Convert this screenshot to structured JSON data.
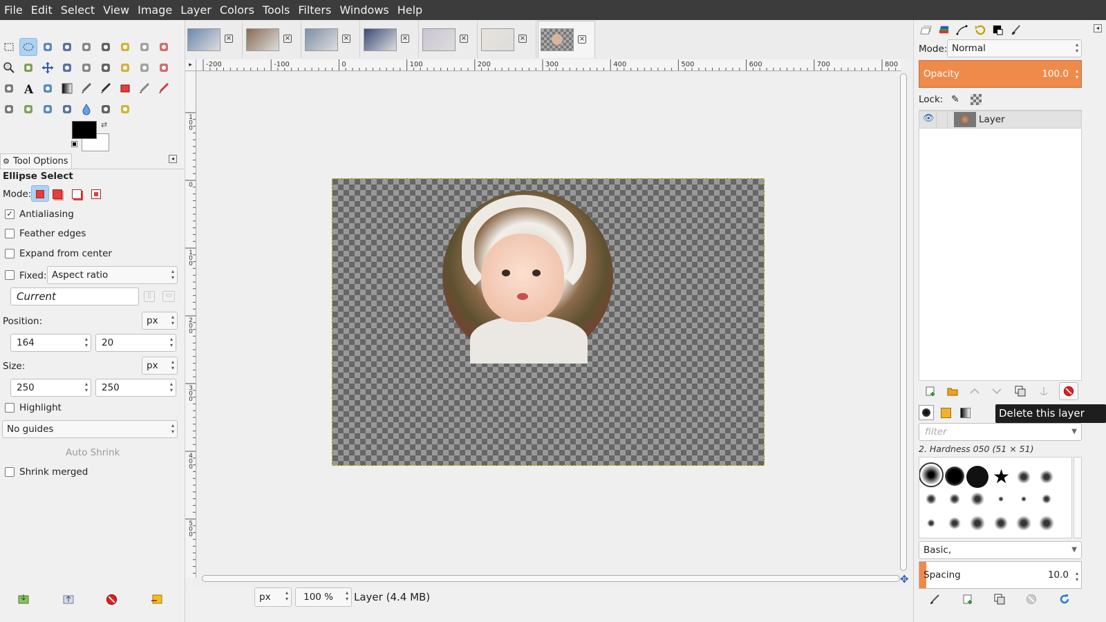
{
  "menu": [
    "File",
    "Edit",
    "Select",
    "View",
    "Image",
    "Layer",
    "Colors",
    "Tools",
    "Filters",
    "Windows",
    "Help"
  ],
  "toolbox": {
    "tools": [
      "rect-select",
      "ellipse-select",
      "free-select",
      "fuzzy-select",
      "select-by-color",
      "scissors-select",
      "foreground-select",
      "paths",
      "color-picker",
      "zoom",
      "measure",
      "move",
      "alignment",
      "crop",
      "unified-transform",
      "handle-transform",
      "warp-transform",
      "cage-transform",
      "flip",
      "text",
      "bucket-fill",
      "gradient",
      "pencil",
      "paintbrush",
      "eraser",
      "airbrush",
      "ink",
      "mypaint-brush",
      "clone",
      "heal",
      "perspective-clone",
      "blur",
      "smudge",
      "dodge"
    ]
  },
  "tool_options": {
    "tab_label": "Tool Options",
    "tool_name": "Ellipse Select",
    "mode_label": "Mode:",
    "antialiasing": "Antialiasing",
    "feather": "Feather edges",
    "expand": "Expand from center",
    "fixed": "Fixed:",
    "fixed_value": "Aspect ratio",
    "current": "Current",
    "position_label": "Position:",
    "position_unit": "px",
    "pos_x": "164",
    "pos_y": "20",
    "size_label": "Size:",
    "size_unit": "px",
    "size_w": "250",
    "size_h": "250",
    "highlight": "Highlight",
    "guides": "No guides",
    "auto_shrink": "Auto Shrink",
    "shrink_merged": "Shrink merged",
    "antialiasing_checked": true
  },
  "image_tabs": [
    {
      "name": "image-tab-1",
      "color": "#6a88b0"
    },
    {
      "name": "image-tab-2",
      "color": "#8a6a55"
    },
    {
      "name": "image-tab-3",
      "color": "#7d8fa8"
    },
    {
      "name": "image-tab-4",
      "color": "#3a4a7a"
    },
    {
      "name": "image-tab-5",
      "color": "#c9c4d4"
    },
    {
      "name": "image-tab-6",
      "color": "#e8e2dc"
    },
    {
      "name": "image-tab-7",
      "color": "#8a8a8a"
    }
  ],
  "ruler": {
    "h_labels": [
      "-200",
      "-100",
      "0",
      "100",
      "200",
      "300",
      "400",
      "500",
      "600",
      "700",
      "800"
    ],
    "v_labels": [
      "100",
      "0",
      "100",
      "200",
      "300",
      "400",
      "500"
    ]
  },
  "status": {
    "unit": "px",
    "zoom": "100 %",
    "info": "Layer (4.4 MB)"
  },
  "layers_panel": {
    "mode_label": "Mode:",
    "mode_value": "Normal",
    "opacity_label": "Opacity",
    "opacity_value": "100.0",
    "lock_label": "Lock:",
    "layer_name": "Layer"
  },
  "tooltip": "Delete this layer",
  "brushes": {
    "filter_placeholder": "filter",
    "selected": "2. Hardness 050 (51 × 51)",
    "tag": "Basic,",
    "spacing_label": "Spacing",
    "spacing_value": "10.0"
  }
}
